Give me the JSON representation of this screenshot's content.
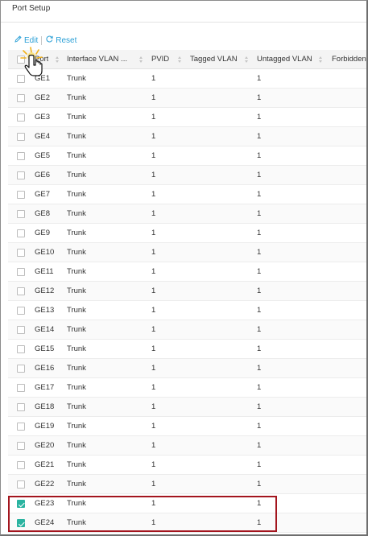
{
  "panel": {
    "title": "Port Setup"
  },
  "toolbar": {
    "edit_label": "Edit",
    "reset_label": "Reset"
  },
  "table": {
    "headers": {
      "port": "Port",
      "interface_vlan": "Interface VLAN ...",
      "pvid": "PVID",
      "tagged_vlan": "Tagged VLAN",
      "untagged_vlan": "Untagged VLAN",
      "forbidden": "Forbidden"
    },
    "rows": [
      {
        "port": "GE1",
        "mode": "Trunk",
        "pvid": "1",
        "untagged": "1",
        "checked": false
      },
      {
        "port": "GE2",
        "mode": "Trunk",
        "pvid": "1",
        "untagged": "1",
        "checked": false
      },
      {
        "port": "GE3",
        "mode": "Trunk",
        "pvid": "1",
        "untagged": "1",
        "checked": false
      },
      {
        "port": "GE4",
        "mode": "Trunk",
        "pvid": "1",
        "untagged": "1",
        "checked": false
      },
      {
        "port": "GE5",
        "mode": "Trunk",
        "pvid": "1",
        "untagged": "1",
        "checked": false
      },
      {
        "port": "GE6",
        "mode": "Trunk",
        "pvid": "1",
        "untagged": "1",
        "checked": false
      },
      {
        "port": "GE7",
        "mode": "Trunk",
        "pvid": "1",
        "untagged": "1",
        "checked": false
      },
      {
        "port": "GE8",
        "mode": "Trunk",
        "pvid": "1",
        "untagged": "1",
        "checked": false
      },
      {
        "port": "GE9",
        "mode": "Trunk",
        "pvid": "1",
        "untagged": "1",
        "checked": false
      },
      {
        "port": "GE10",
        "mode": "Trunk",
        "pvid": "1",
        "untagged": "1",
        "checked": false
      },
      {
        "port": "GE11",
        "mode": "Trunk",
        "pvid": "1",
        "untagged": "1",
        "checked": false
      },
      {
        "port": "GE12",
        "mode": "Trunk",
        "pvid": "1",
        "untagged": "1",
        "checked": false
      },
      {
        "port": "GE13",
        "mode": "Trunk",
        "pvid": "1",
        "untagged": "1",
        "checked": false
      },
      {
        "port": "GE14",
        "mode": "Trunk",
        "pvid": "1",
        "untagged": "1",
        "checked": false
      },
      {
        "port": "GE15",
        "mode": "Trunk",
        "pvid": "1",
        "untagged": "1",
        "checked": false
      },
      {
        "port": "GE16",
        "mode": "Trunk",
        "pvid": "1",
        "untagged": "1",
        "checked": false
      },
      {
        "port": "GE17",
        "mode": "Trunk",
        "pvid": "1",
        "untagged": "1",
        "checked": false
      },
      {
        "port": "GE18",
        "mode": "Trunk",
        "pvid": "1",
        "untagged": "1",
        "checked": false
      },
      {
        "port": "GE19",
        "mode": "Trunk",
        "pvid": "1",
        "untagged": "1",
        "checked": false
      },
      {
        "port": "GE20",
        "mode": "Trunk",
        "pvid": "1",
        "untagged": "1",
        "checked": false
      },
      {
        "port": "GE21",
        "mode": "Trunk",
        "pvid": "1",
        "untagged": "1",
        "checked": false
      },
      {
        "port": "GE22",
        "mode": "Trunk",
        "pvid": "1",
        "untagged": "1",
        "checked": false
      },
      {
        "port": "GE23",
        "mode": "Trunk",
        "pvid": "1",
        "untagged": "1",
        "checked": true
      },
      {
        "port": "GE24",
        "mode": "Trunk",
        "pvid": "1",
        "untagged": "1",
        "checked": true
      }
    ]
  },
  "colors": {
    "accent": "#2a9fd6",
    "checkbox_checked": "#2ab3a0",
    "highlight_border": "#a3151e"
  },
  "icons": {
    "edit": "pencil-icon",
    "reset": "refresh-icon",
    "cursor": "hand-pointer-icon"
  }
}
